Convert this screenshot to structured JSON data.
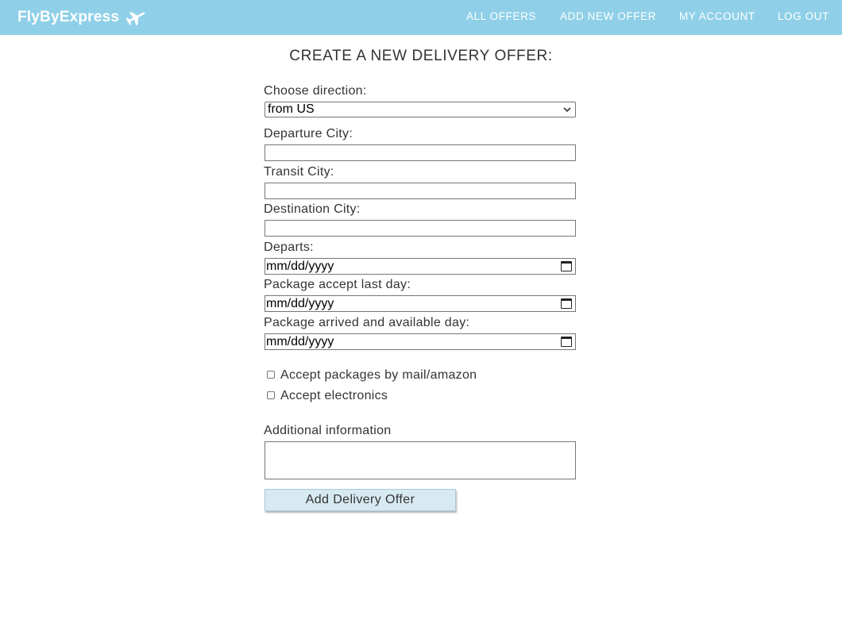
{
  "nav": {
    "brand": "FlyByExpress",
    "brand_icon": "airplane-icon",
    "links": [
      "ALL OFFERS",
      "ADD NEW OFFER",
      "MY ACCOUNT",
      "LOG OUT"
    ],
    "color": "#8fd0e8"
  },
  "form": {
    "title": "CREATE A NEW DELIVERY OFFER:",
    "direction_label": "Choose direction:",
    "direction_value": "from US",
    "departure_label": "Departure City:",
    "transit_label": "Transit City:",
    "destination_label": "Destination City:",
    "departs_label": "Departs:",
    "departs_placeholder": "mm/dd/yyyy",
    "accept_last_label": "Package accept last day:",
    "accept_last_placeholder": "mm/dd/yyyy",
    "arrived_label": "Package arrived and available day:",
    "arrived_placeholder": "mm/dd/yyyy",
    "mail_label": "Accept packages by mail/amazon",
    "electronics_label": "Accept electronics",
    "additional_label": "Additional information",
    "submit_label": "Add Delivery Offer",
    "submit_color": "#d7eaf1"
  }
}
